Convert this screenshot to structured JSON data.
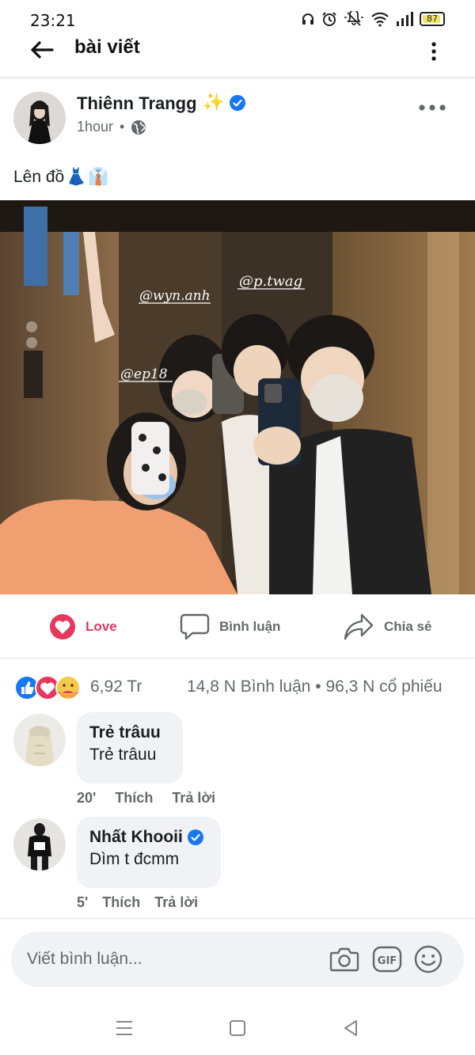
{
  "status_bar": {
    "time": "23:21",
    "battery": "87"
  },
  "header": {
    "title": "bài viết"
  },
  "post": {
    "author": "Thiênn Trangg",
    "author_emoji": "✨",
    "time": "1hour",
    "separator": "•",
    "text": "Lên đồ",
    "text_emojis": [
      "👗",
      "👔"
    ],
    "photo_tags": [
      "@p.twag",
      "@wyn.anh",
      "@ep18"
    ]
  },
  "actions": {
    "love": "Love",
    "comment": "Bình luận",
    "share": "Chia sẻ"
  },
  "stats": {
    "reactions": "6,92 Tr",
    "comments_shares": "14,8 N  Bình luận • 96,3 N  cổ phiếu"
  },
  "comments": [
    {
      "name": "Trẻ trâuu",
      "text": "Trẻ trâuu",
      "verified": false,
      "time": "20'",
      "like": "Thích",
      "reply": "Trả lời"
    },
    {
      "name": "Nhất Khooii",
      "text": "Dìm t đcmm",
      "verified": true,
      "time": "5'",
      "like": "Thích",
      "reply": "Trả lời"
    }
  ],
  "composer": {
    "placeholder": "Viết bình luận..."
  },
  "colors": {
    "accent_blue": "#1877f2",
    "love_red": "#e8365d",
    "secondary_text": "#65676b",
    "bubble_bg": "#f0f2f5"
  },
  "icons": {
    "status": [
      "headphones-icon",
      "alarm-icon",
      "mute-icon",
      "wifi-icon",
      "signal-icon",
      "battery-icon"
    ],
    "header": [
      "back-arrow-icon",
      "more-vertical-icon"
    ],
    "post": [
      "globe-icon",
      "more-horizontal-icon",
      "verified-badge-icon"
    ],
    "actions": [
      "heart-icon",
      "speech-bubble-icon",
      "share-arrow-icon"
    ],
    "composer": [
      "camera-icon",
      "gif-icon",
      "smiley-icon"
    ],
    "nav": [
      "menu-icon",
      "home-square-icon",
      "back-triangle-icon"
    ]
  }
}
